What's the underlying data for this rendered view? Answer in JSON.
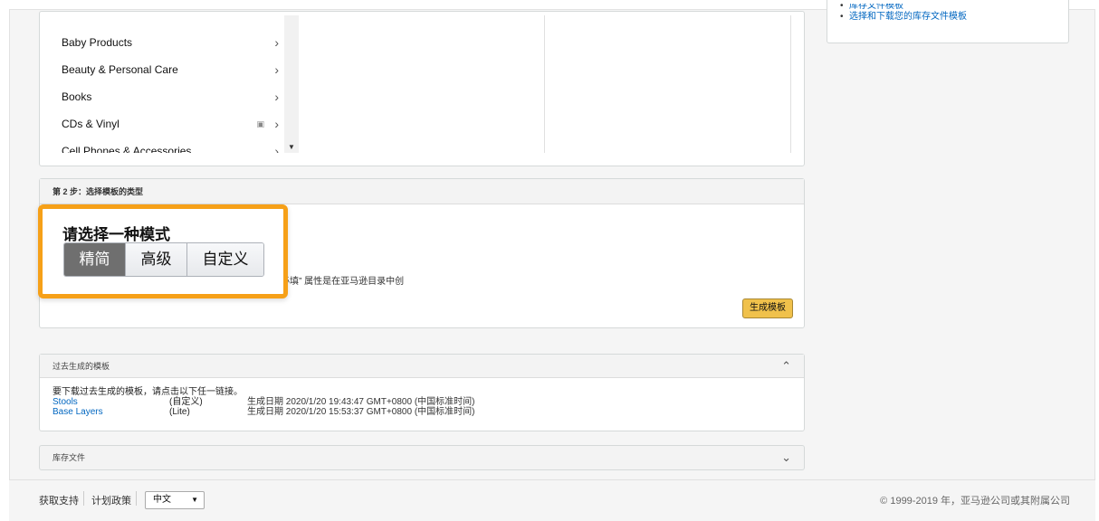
{
  "categories": {
    "items": [
      {
        "label": "Baby Products",
        "locked": false
      },
      {
        "label": "Beauty & Personal Care",
        "locked": false
      },
      {
        "label": "Books",
        "locked": false
      },
      {
        "label": "CDs & Vinyl",
        "locked": true
      },
      {
        "label": "Cell Phones & Accessories",
        "locked": false
      }
    ]
  },
  "step2": {
    "header": "第 2 步：选择模板的类型",
    "note": "必填” 属性是在亚马逊目录中创",
    "generate_button": "生成模板"
  },
  "mode_selector": {
    "title": "请选择一种模式",
    "options": [
      "精简",
      "高级",
      "自定义"
    ],
    "selected": "精简"
  },
  "past_templates": {
    "header": "过去生成的模板",
    "intro": "要下载过去生成的模板，请点击以下任一链接。",
    "rows": [
      {
        "name": "Stools",
        "mode": "(自定义)",
        "date": "生成日期 2020/1/20 19:43:47 GMT+0800 (中国标准时间)"
      },
      {
        "name": "Base Layers",
        "mode": "(Lite)",
        "date": "生成日期 2020/1/20 15:53:37 GMT+0800 (中国标准时间)"
      }
    ]
  },
  "inventory_files": {
    "header": "库存文件"
  },
  "help_links": [
    "库存文件模板",
    "选择和下载您的库存文件模板"
  ],
  "footer": {
    "support": "获取支持",
    "policy": "计划政策",
    "language": "中文",
    "copyright": "© 1999-2019 年，亚马逊公司或其附属公司"
  },
  "colors": {
    "highlight": "#f6a018",
    "link": "#0066c0",
    "button_yellow": "#f0c14b",
    "active_segment": "#6f6f6f"
  }
}
